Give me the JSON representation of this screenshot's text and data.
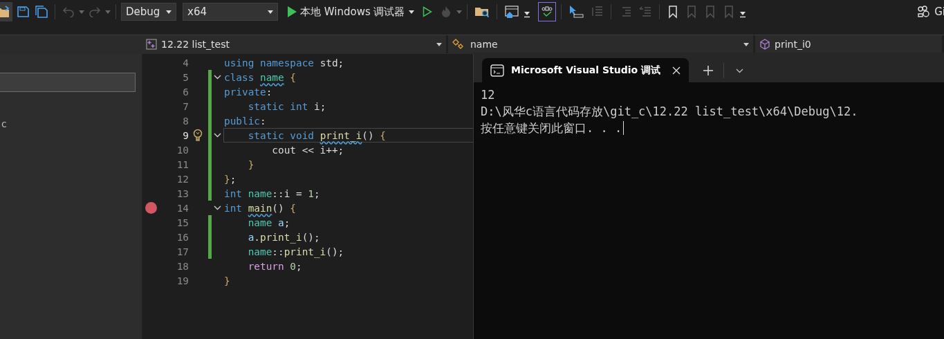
{
  "toolbar": {
    "undo": {
      "disabled": true
    },
    "redo": {
      "disabled": true
    },
    "configuration": {
      "value": "Debug"
    },
    "platform": {
      "value": "x64"
    },
    "start_debugging": {
      "label": "本地 Windows 调试器"
    },
    "spell_check": {
      "selected": true
    },
    "git": {
      "label": "Gi"
    }
  },
  "navigation_bar": {
    "project": "12.22 list_test",
    "scope": "name",
    "member": "print_i0"
  },
  "left_panel": {
    "text_fragment": "c"
  },
  "editor": {
    "lines": [
      {
        "number": "4",
        "changed": false,
        "breakpoint": false,
        "lightbulb": false,
        "foldable": false,
        "current": false,
        "tokens": [
          {
            "t": "using namespace ",
            "kind": "keyword"
          },
          {
            "t": "std;",
            "kind": "plain"
          }
        ]
      },
      {
        "number": "5",
        "changed": true,
        "breakpoint": false,
        "lightbulb": false,
        "foldable": true,
        "current": false,
        "tokens": [
          {
            "t": "class ",
            "kind": "keyword"
          },
          {
            "t": "name",
            "kind": "type",
            "squiggle": true
          },
          {
            "t": " {",
            "kind": "brace"
          }
        ]
      },
      {
        "number": "6",
        "changed": true,
        "breakpoint": false,
        "lightbulb": false,
        "foldable": false,
        "current": false,
        "tokens": [
          {
            "t": "private",
            "kind": "keyword"
          },
          {
            "t": ":",
            "kind": "plain"
          }
        ]
      },
      {
        "number": "7",
        "changed": true,
        "breakpoint": false,
        "lightbulb": false,
        "foldable": false,
        "current": false,
        "tokens": [
          {
            "t": "    static int ",
            "kind": "keyword"
          },
          {
            "t": "i;",
            "kind": "plain"
          }
        ]
      },
      {
        "number": "8",
        "changed": true,
        "breakpoint": false,
        "lightbulb": false,
        "foldable": false,
        "current": false,
        "tokens": [
          {
            "t": "public",
            "kind": "keyword"
          },
          {
            "t": ":",
            "kind": "plain"
          }
        ]
      },
      {
        "number": "9",
        "changed": true,
        "breakpoint": false,
        "lightbulb": true,
        "foldable": true,
        "current": true,
        "tokens": [
          {
            "t": "    static void ",
            "kind": "keyword"
          },
          {
            "t": "print_i",
            "kind": "function",
            "squiggle": true
          },
          {
            "t": "()",
            "kind": "plain"
          },
          {
            "t": " {",
            "kind": "brace"
          }
        ]
      },
      {
        "number": "10",
        "changed": true,
        "breakpoint": false,
        "lightbulb": false,
        "foldable": false,
        "current": false,
        "tokens": [
          {
            "t": "        cout << i++;",
            "kind": "plain"
          }
        ]
      },
      {
        "number": "11",
        "changed": true,
        "breakpoint": false,
        "lightbulb": false,
        "foldable": false,
        "current": false,
        "tokens": [
          {
            "t": "    }",
            "kind": "brace"
          }
        ]
      },
      {
        "number": "12",
        "changed": true,
        "breakpoint": false,
        "lightbulb": false,
        "foldable": false,
        "current": false,
        "tokens": [
          {
            "t": "}",
            "kind": "brace"
          },
          {
            "t": ";",
            "kind": "plain"
          }
        ]
      },
      {
        "number": "13",
        "changed": true,
        "breakpoint": false,
        "lightbulb": false,
        "foldable": false,
        "current": false,
        "tokens": [
          {
            "t": "int ",
            "kind": "keyword"
          },
          {
            "t": "name",
            "kind": "type"
          },
          {
            "t": "::i = ",
            "kind": "plain"
          },
          {
            "t": "1",
            "kind": "number"
          },
          {
            "t": ";",
            "kind": "plain"
          }
        ]
      },
      {
        "number": "14",
        "changed": false,
        "breakpoint": true,
        "lightbulb": false,
        "foldable": true,
        "current": false,
        "tokens": [
          {
            "t": "int ",
            "kind": "keyword"
          },
          {
            "t": "main",
            "kind": "function",
            "squiggle": true
          },
          {
            "t": "() ",
            "kind": "plain"
          },
          {
            "t": "{",
            "kind": "brace"
          }
        ]
      },
      {
        "number": "15",
        "changed": true,
        "breakpoint": false,
        "lightbulb": false,
        "foldable": false,
        "current": false,
        "tokens": [
          {
            "t": "    name ",
            "kind": "type"
          },
          {
            "t": "a",
            "kind": "variable"
          },
          {
            "t": ";",
            "kind": "plain"
          }
        ]
      },
      {
        "number": "16",
        "changed": true,
        "breakpoint": false,
        "lightbulb": false,
        "foldable": false,
        "current": false,
        "tokens": [
          {
            "t": "    a",
            "kind": "variable"
          },
          {
            "t": ".",
            "kind": "plain"
          },
          {
            "t": "print_i",
            "kind": "function"
          },
          {
            "t": "();",
            "kind": "plain"
          }
        ]
      },
      {
        "number": "17",
        "changed": true,
        "breakpoint": false,
        "lightbulb": false,
        "foldable": false,
        "current": false,
        "tokens": [
          {
            "t": "    name",
            "kind": "type"
          },
          {
            "t": "::",
            "kind": "plain"
          },
          {
            "t": "print_i",
            "kind": "function"
          },
          {
            "t": "();",
            "kind": "plain"
          }
        ]
      },
      {
        "number": "18",
        "changed": false,
        "breakpoint": false,
        "lightbulb": false,
        "foldable": false,
        "current": false,
        "tokens": [
          {
            "t": "    return",
            "kind": "control"
          },
          {
            "t": " 0",
            "kind": "number"
          },
          {
            "t": ";",
            "kind": "plain"
          }
        ]
      },
      {
        "number": "19",
        "changed": false,
        "breakpoint": false,
        "lightbulb": false,
        "foldable": false,
        "current": false,
        "tokens": [
          {
            "t": "}",
            "kind": "brace"
          }
        ]
      }
    ]
  },
  "console": {
    "tab": {
      "title": "Microsoft Visual Studio 调试",
      "selected": true
    },
    "output": [
      "12",
      "D:\\风华c语言代码存放\\git_c\\12.22 list_test\\x64\\Debug\\12.",
      "按任意键关闭此窗口. . ."
    ]
  }
}
